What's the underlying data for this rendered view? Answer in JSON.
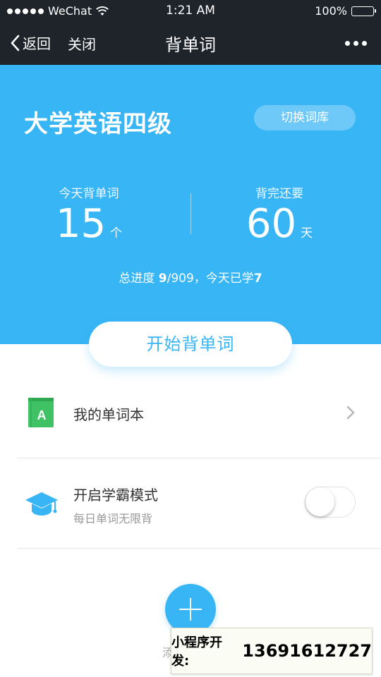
{
  "status_bar": {
    "carrier": "WeChat",
    "time": "1:21 AM",
    "battery": "100%"
  },
  "nav": {
    "back_label": "返回",
    "close_label": "关闭",
    "title": "背单词"
  },
  "hero": {
    "book_title": "大学英语四级",
    "switch_label": "切换词库",
    "today": {
      "label": "今天背单词",
      "value": "15",
      "unit": "个"
    },
    "remaining": {
      "label": "背完还要",
      "value": "60",
      "unit": "天"
    },
    "progress": {
      "prefix": "总进度 ",
      "done": "9",
      "total": "/909",
      "mid": "，今天已学",
      "today_learned": "7"
    }
  },
  "start_button_label": "开始背单词",
  "list": {
    "wordbook": {
      "label": "我的单词本",
      "icon_letter": "A",
      "icon": "book-icon"
    },
    "master_mode": {
      "label": "开启学霸模式",
      "subtitle": "每日单词无限背",
      "icon": "graduation-cap-icon",
      "enabled": false
    }
  },
  "add": {
    "label": "添"
  },
  "watermark": {
    "label": "小程序开发:",
    "phone": "13691612727"
  },
  "colors": {
    "nav_bg": "#1f242b",
    "accent": "#38b5f5",
    "book_green": "#3ec263"
  }
}
